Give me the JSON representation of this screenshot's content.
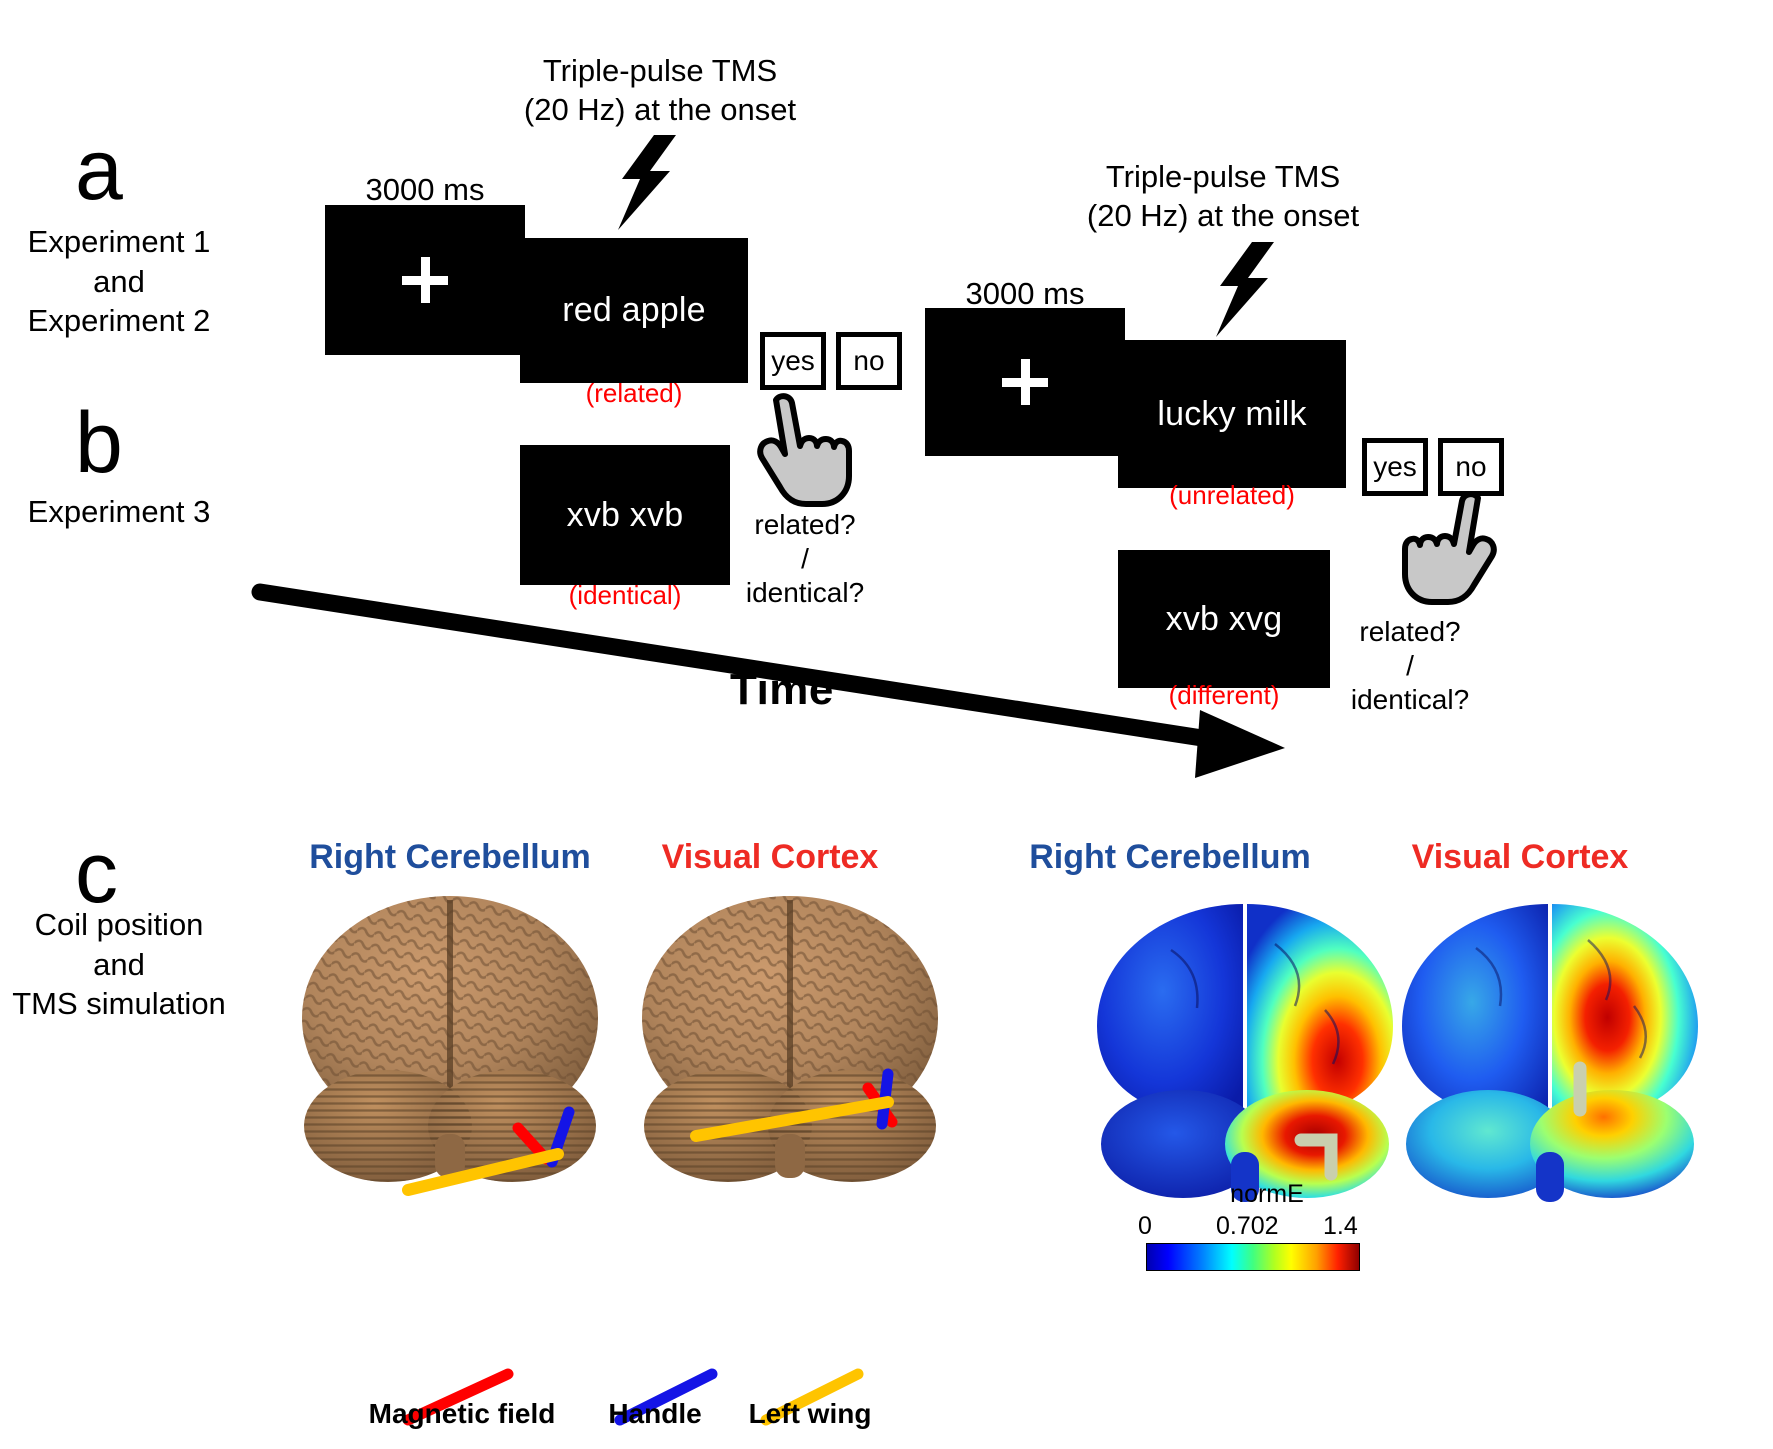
{
  "figure": {
    "panels": [
      {
        "letter": "a",
        "caption": "Experiment 1\nand\nExperiment 2"
      },
      {
        "letter": "b",
        "caption": "Experiment 3"
      },
      {
        "letter": "c",
        "caption": "Coil position\nand\nTMS simulation"
      }
    ],
    "timeline": {
      "axis_label": "Time"
    },
    "trials": [
      {
        "id": "trial-left",
        "fixation_duration": "3000 ms",
        "fixation_symbol": "+",
        "tms_note": "Triple-pulse TMS\n(20 Hz) at the onset",
        "word_stimulus": "red apple",
        "word_condition": "(related)",
        "nonword_stimulus": "xvb xvb",
        "nonword_condition": "(identical)",
        "response_options": [
          "yes",
          "no"
        ],
        "response_question": "related?\n/\nidentical?"
      },
      {
        "id": "trial-right",
        "fixation_duration": "3000 ms",
        "fixation_symbol": "+",
        "tms_note": "Triple-pulse TMS\n(20 Hz) at the onset",
        "word_stimulus": "lucky milk",
        "word_condition": "(unrelated)",
        "nonword_stimulus": "xvb xvg",
        "nonword_condition": "(different)",
        "response_options": [
          "yes",
          "no"
        ],
        "response_question": "related?\n/\nidentical?"
      }
    ],
    "simulation": {
      "brain_titles": [
        {
          "text": "Right Cerebellum",
          "color": "#1f4e9c"
        },
        {
          "text": "Visual Cortex",
          "color": "#ee2b24"
        },
        {
          "text": "Right Cerebellum",
          "color": "#1f4e9c"
        },
        {
          "text": "Visual Cortex",
          "color": "#ee2b24"
        }
      ],
      "coil_legend": [
        {
          "label": "Magnetic field",
          "color": "#ff0000"
        },
        {
          "label": "Handle",
          "color": "#1414e6"
        },
        {
          "label": "Left wing",
          "color": "#ffc400"
        }
      ],
      "colorbar": {
        "title": "normE",
        "ticks": [
          "0",
          "0.702",
          "1.4"
        ]
      }
    }
  },
  "chart_data": {
    "type": "heatmap",
    "title": "normE",
    "colorbar_ticks": [
      0,
      0.702,
      1.4
    ],
    "colormap": "jet",
    "panels": [
      {
        "name": "Right Cerebellum coil position",
        "rendering": "anatomical"
      },
      {
        "name": "Visual Cortex coil position",
        "rendering": "anatomical"
      },
      {
        "name": "Right Cerebellum normE",
        "peak_region": "right cerebellum",
        "peak_value": 1.4
      },
      {
        "name": "Visual Cortex normE",
        "peak_region": "right occipital cortex",
        "peak_value": 1.4
      }
    ]
  }
}
